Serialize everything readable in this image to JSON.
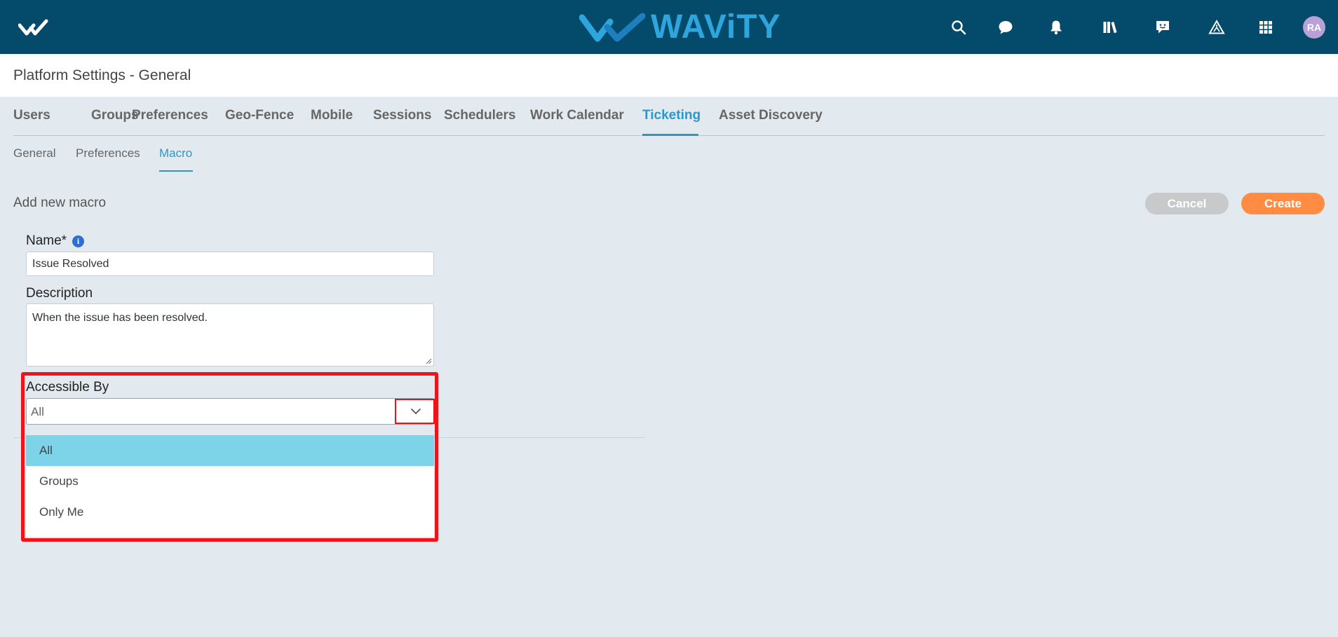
{
  "brand": {
    "name": "WAViTY"
  },
  "topbar": {
    "icons": [
      "search-icon",
      "chat-icon",
      "bell-icon",
      "library-icon",
      "feedback-icon",
      "alert-triangle-icon",
      "apps-grid-icon"
    ],
    "avatar_initials": "RA",
    "avatar_color": "#b9a0d6",
    "background_color": "#034a6b"
  },
  "page": {
    "title": "Platform Settings - General"
  },
  "tabs": [
    {
      "label": "Users"
    },
    {
      "label": "Groups"
    },
    {
      "label": "Preferences"
    },
    {
      "label": "Geo-Fence"
    },
    {
      "label": "Mobile"
    },
    {
      "label": "Sessions"
    },
    {
      "label": "Schedulers"
    },
    {
      "label": "Work Calendar"
    },
    {
      "label": "Ticketing",
      "active": true
    },
    {
      "label": "Asset Discovery"
    }
  ],
  "subtabs": [
    {
      "label": "General"
    },
    {
      "label": "Preferences"
    },
    {
      "label": "Macro",
      "active": true
    }
  ],
  "form": {
    "section_title": "Add new macro",
    "cancel_label": "Cancel",
    "create_label": "Create",
    "name_label": "Name*",
    "name_value": "Issue Resolved",
    "description_label": "Description",
    "description_value": "When the issue has been resolved.",
    "accessible_label": "Accessible By",
    "accessible_value": "All",
    "accessible_options": [
      {
        "label": "All",
        "selected": true
      },
      {
        "label": "Groups"
      },
      {
        "label": "Only Me"
      }
    ]
  },
  "colors": {
    "accent": "#2f97c8",
    "create_button": "#ff8c42",
    "cancel_button": "#c7c9cb",
    "selected_option": "#7dd4e8",
    "highlight": "#f0141a"
  }
}
